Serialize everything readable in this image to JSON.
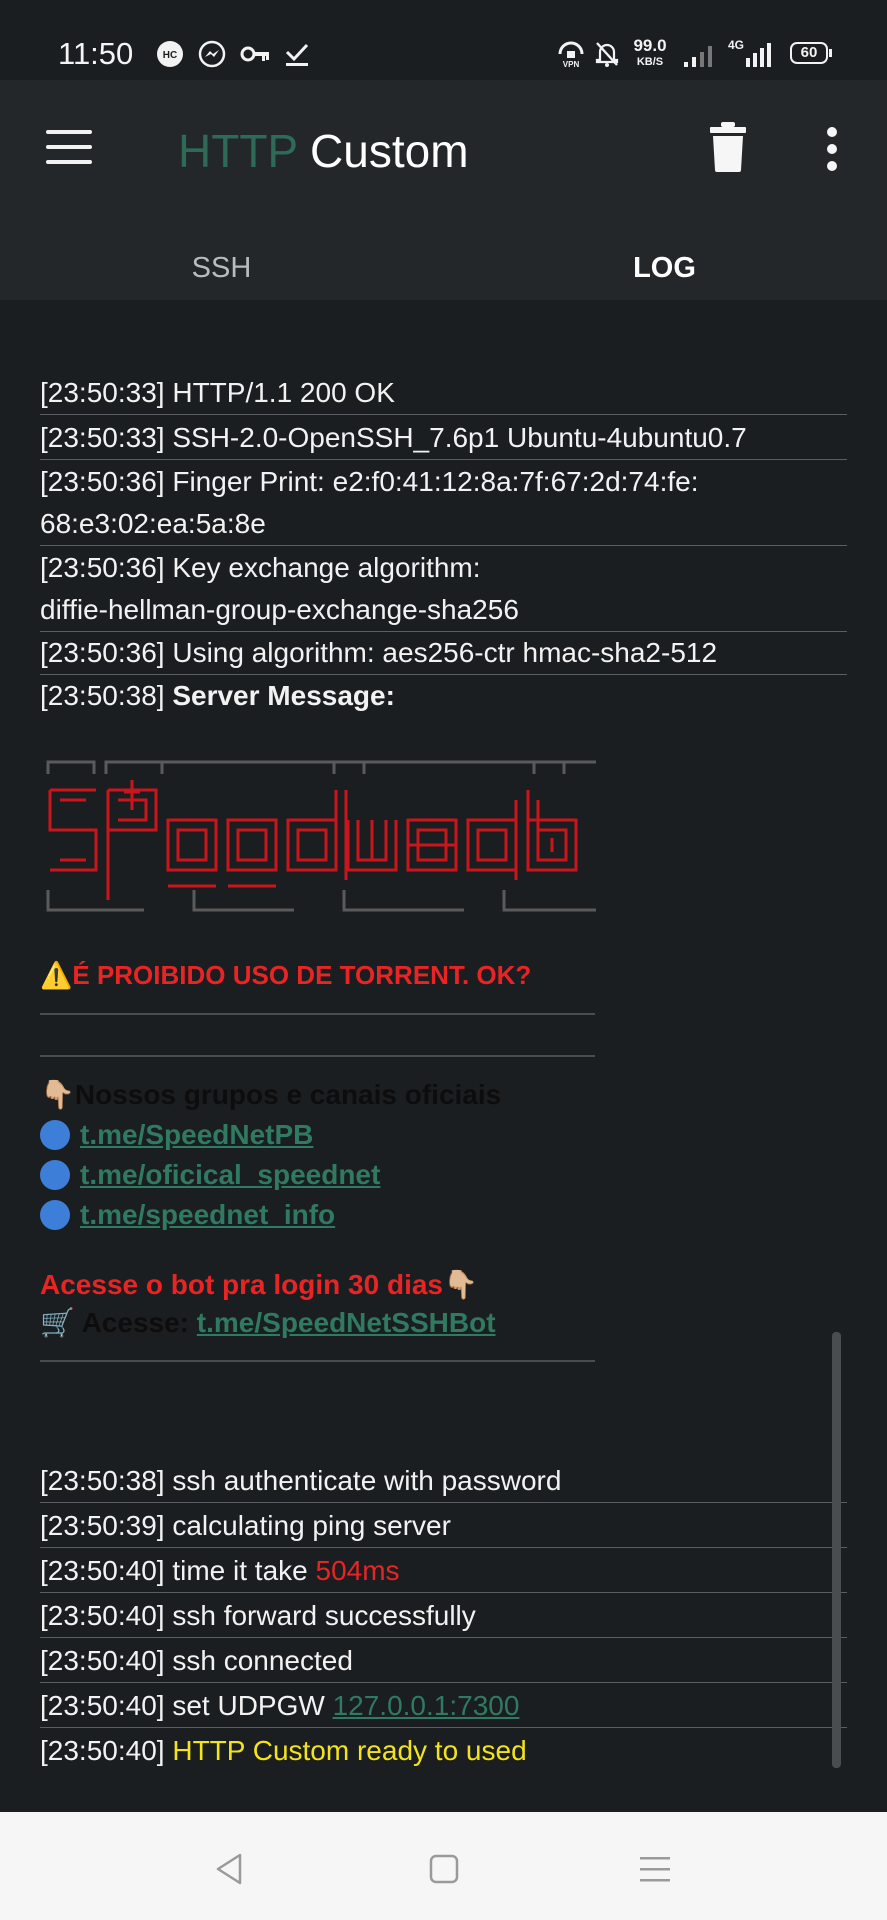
{
  "status_bar": {
    "time": "11:50",
    "speed_value": "99.0",
    "speed_unit": "KB/S",
    "net_type": "4G",
    "battery": "60",
    "icons": [
      "hc-icon",
      "messenger-icon",
      "key-icon",
      "download-done-icon",
      "vpn-icon",
      "bell-off-icon",
      "signal-icon",
      "signal-4g-icon",
      "battery-icon"
    ]
  },
  "app": {
    "title_part1": "HTTP",
    "title_part2": " Custom",
    "accent": "#2e6b57"
  },
  "tabs": [
    {
      "label": "SSH",
      "active": false
    },
    {
      "label": "LOG",
      "active": true
    }
  ],
  "log": {
    "top_entries": [
      {
        "time": "[23:50:33]",
        "text": "HTTP/1.1 200 OK"
      },
      {
        "time": "[23:50:33]",
        "text": "SSH-2.0-OpenSSH_7.6p1 Ubuntu-4ubuntu0.7"
      },
      {
        "time": "[23:50:36]",
        "text": "Finger Print: e2:f0:41:12:8a:7f:67:2d:74:fe:",
        "text2": "68:e3:02:ea:5a:8e"
      },
      {
        "time": "[23:50:36]",
        "text": "Key exchange algorithm:",
        "text2": "diffie-hellman-group-exchange-sha256"
      },
      {
        "time": "[23:50:36]",
        "text": "Using algorithm: aes256-ctr hmac-sha2-512"
      }
    ],
    "server_message_time": "[23:50:38]",
    "server_message_label": "Server Message:",
    "banner_art": "SPEEDNET",
    "warning": "⚠️É PROIBIDO USO DE TORRENT. OK?",
    "groups_title": "👇🏼Nossos grupos e canais oficiais",
    "links": [
      "t.me/SpeedNetPB",
      "t.me/oficical_speednet",
      "t.me/speednet_info"
    ],
    "bot_text": "Acesse o bot pra login 30 dias👇🏼",
    "bot_prefix": "🛒 Acesse: ",
    "bot_link": "t.me/SpeedNetSSHBot",
    "bottom_entries": [
      {
        "time": "[23:50:38]",
        "text": "ssh authenticate with password"
      },
      {
        "time": "[23:50:39]",
        "text": "calculating ping server"
      },
      {
        "time": "[23:50:40]",
        "text": "time it take ",
        "highlight": "504ms"
      },
      {
        "time": "[23:50:40]",
        "text": "ssh forward successfully"
      },
      {
        "time": "[23:50:40]",
        "text": "ssh connected"
      },
      {
        "time": "[23:50:40]",
        "text": "set UDPGW ",
        "link": "127.0.0.1:7300"
      },
      {
        "time": "[23:50:40]",
        "text": "",
        "ready": "HTTP Custom ready to used"
      }
    ]
  },
  "nav": {
    "icons": [
      "back-icon",
      "home-icon",
      "recents-icon"
    ]
  }
}
